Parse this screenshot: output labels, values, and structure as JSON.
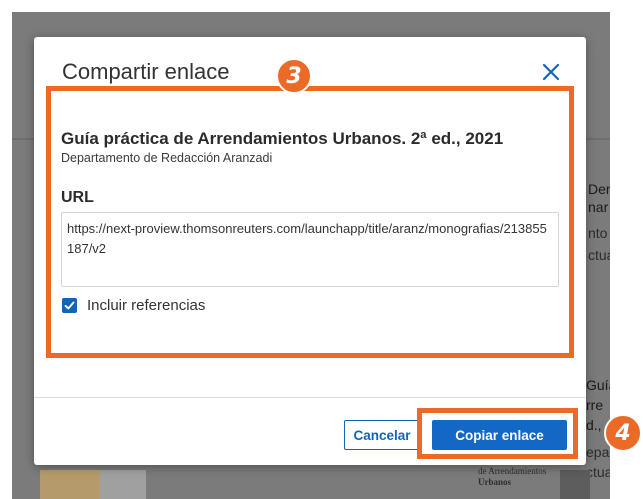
{
  "modal": {
    "title": "Compartir enlace",
    "document_title": "Guía práctica de Arrendamientos Urbanos. 2ª ed., 2021",
    "document_author": "Departamento de Redacción Aranzadi",
    "url_label": "URL",
    "url_value": "https://next-proview.thomsonreuters.com/launchapp/title/aranz/monografias/213855187/v2",
    "include_references_label": "Incluir referencias",
    "include_references_checked": true,
    "cancel_label": "Cancelar",
    "copy_label": "Copiar enlace"
  },
  "annotations": {
    "step_3": "3",
    "step_4": "4",
    "highlight_color": "#ec6a28"
  },
  "background_page": {
    "card1_lines": [
      "Dere",
      "nar",
      "nto",
      "ctua"
    ],
    "card2_lines": [
      "Guía",
      "rre",
      "d.,",
      "epa",
      "ctua"
    ],
    "thumb_text_1": "Urbanos",
    "thumb_text_2": "de Arrendamientos"
  },
  "colors": {
    "primary": "#1268c4",
    "overlay": "#7b7b7b"
  }
}
